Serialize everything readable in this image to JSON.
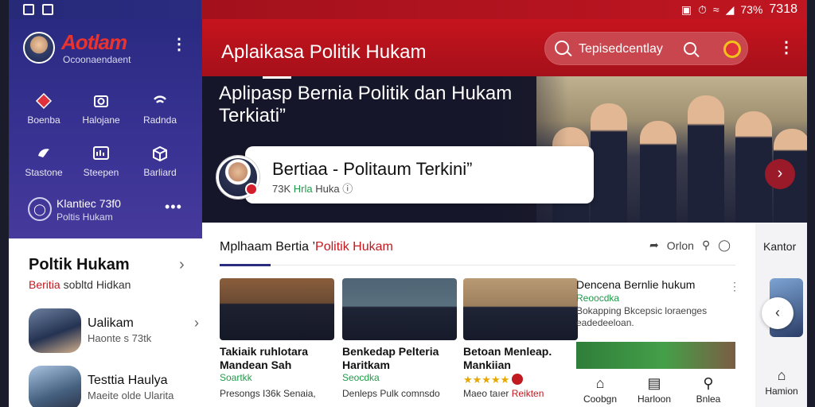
{
  "status_bar": {
    "battery": "73%",
    "time": "7318"
  },
  "sidebar": {
    "logo_text": "Aotlam",
    "profile_sub": "Ocoonaendaent",
    "quick": [
      {
        "label": "Boenba",
        "icon": "diamond-icon"
      },
      {
        "label": "Halojane",
        "icon": "camera-icon"
      },
      {
        "label": "Radnda",
        "icon": "signal-icon"
      },
      {
        "label": "Stastone",
        "icon": "bird-icon"
      },
      {
        "label": "Steepen",
        "icon": "chart-icon"
      },
      {
        "label": "Barliard",
        "icon": "box-icon"
      }
    ],
    "stat_line1": "Klantiec 73f0",
    "stat_line2": "Poltis Hukam",
    "section_title": "Poltik Hukam",
    "section_sub_red": "Beritia",
    "section_sub_rest": " sobltd Hidkan",
    "items": [
      {
        "title": "Ualikam",
        "sub": "Haonte s 73tk"
      },
      {
        "title": "Testtia Haulya",
        "sub": "Maeite olde Ularita"
      }
    ]
  },
  "appbar": {
    "title": "Aplaikasa Politik Hukam",
    "search_placeholder": "Tepisedcentlay"
  },
  "hero": {
    "title": "Aplipasp Bernia Politik dan Hukam Terkiati”",
    "feature_title": "Bertiaa - Politaum Terkini”",
    "feature_meta_count": "73K",
    "feature_meta_green": "Hrla",
    "feature_meta_rest": "Huka"
  },
  "section": {
    "title_main": "Mplhaam Bertia ’",
    "title_red": "Politik Hukam",
    "tool_label": "Orlon"
  },
  "cards": [
    {
      "title": "Takiaik ruhlotara Mandean Sah",
      "source": "Soartkk",
      "desc": "Presongs I36k Senaia,"
    },
    {
      "title": "Benkedap Pelteria Haritkam",
      "source": "Seocdka",
      "desc": "Denleps Pulk comnsdo"
    },
    {
      "title": "Betoan Menleap. Mankiian",
      "source": "",
      "stars": "★★★★★",
      "desc_plain": "Maeo taıer ",
      "desc_red": "Reikten"
    }
  ],
  "side_card": {
    "title": "Dencena Bernlie hukum",
    "source": "Reoocdka",
    "desc": "Bokapping Bkcepsic loraenges eadedeeloan."
  },
  "bottom_nav": [
    {
      "label": "Coobgn",
      "icon": "home-icon"
    },
    {
      "label": "Harloon",
      "icon": "doc-icon"
    },
    {
      "label": "Bnlea",
      "icon": "person-icon"
    }
  ],
  "right_panel": {
    "label": "Kantor",
    "home_label": "Hamion"
  }
}
